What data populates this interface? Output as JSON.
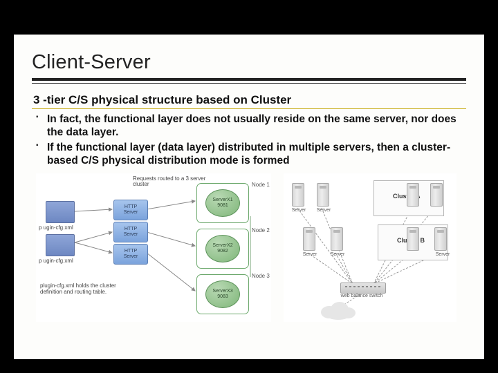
{
  "title": "Client-Server",
  "subtitle": "3 -tier C/S physical structure based on Cluster",
  "bullets": [
    "In fact, the functional layer does not usually reside on the same server, nor does the data layer.",
    "If the functional layer (data layer) distributed in multiple servers, then a cluster-based C/S physical distribution mode is formed"
  ],
  "diagram1": {
    "xml_label_top": "p ugin-cfg.xml",
    "xml_label_mid": "p ugin-cfg.xml",
    "http_label_line1": "HTTP",
    "http_label_line2": "Server",
    "route_note": "Requests routed to a 3 server cluster",
    "node_label": "Node",
    "server1_name": "ServerX1",
    "server1_port": "9081",
    "server2_name": "ServerX2",
    "server2_port": "9082",
    "server3_name": "ServerX3",
    "server3_port": "9083",
    "footnote": "plugin-cfg.xml holds the cluster definition and routing table."
  },
  "diagram2": {
    "server_label": "Server",
    "cluster_a": "Cluster A",
    "cluster_b": "Cluster B",
    "switch_label": "web balance switch"
  }
}
